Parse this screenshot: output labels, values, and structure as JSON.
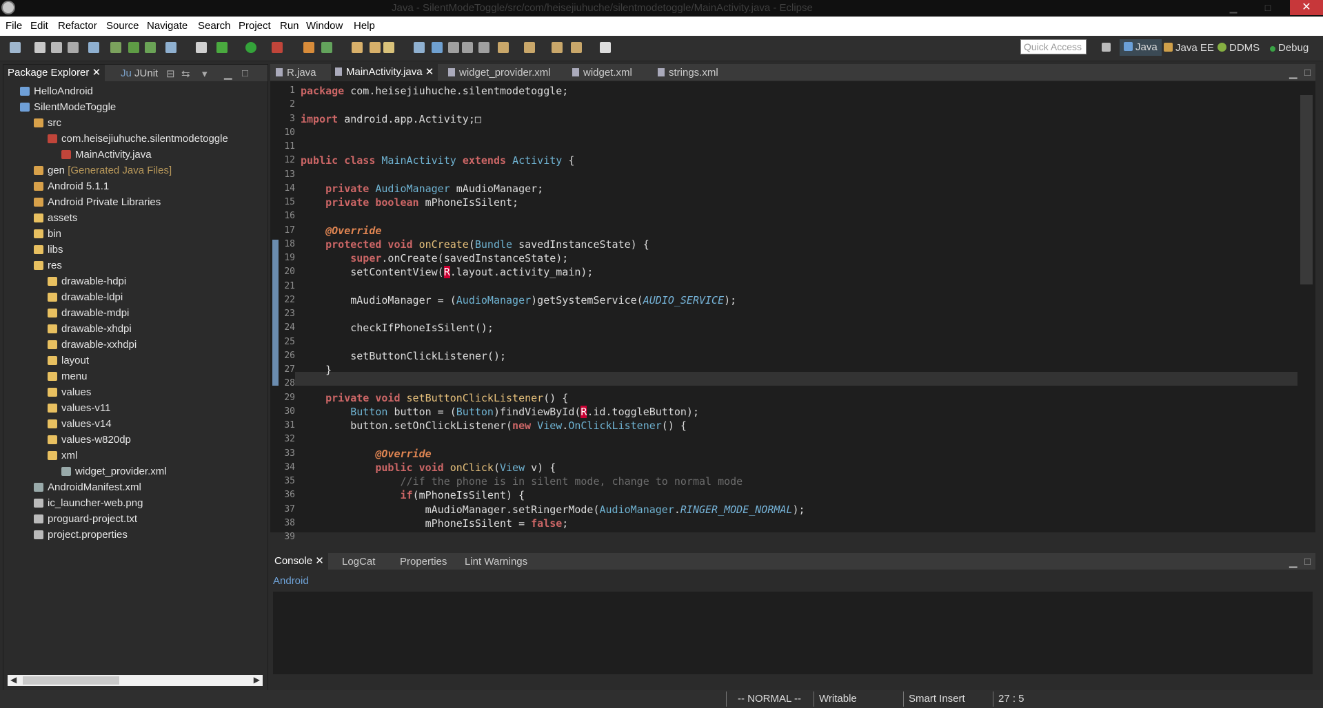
{
  "window": {
    "title": "Java - SilentModeToggle/src/com/heisejiuhuche/silentmodetoggle/MainActivity.java - Eclipse",
    "close": "✕",
    "minimize": "▁",
    "maximize": "□"
  },
  "menu": [
    "File",
    "Edit",
    "Refactor",
    "Source",
    "Navigate",
    "Search",
    "Project",
    "Run",
    "Window",
    "Help"
  ],
  "quick_access": "Quick Access",
  "perspectives": [
    "Java",
    "Java EE",
    "DDMS",
    "Debug"
  ],
  "left_tabs": {
    "explorer": "Package Explorer",
    "junit": "JUnit"
  },
  "tree": [
    {
      "label": "HelloAndroid",
      "indent": 0,
      "icon": "project-icon"
    },
    {
      "label": "SilentModeToggle",
      "indent": 0,
      "icon": "project-icon"
    },
    {
      "label": "src",
      "indent": 1,
      "icon": "source-folder-icon"
    },
    {
      "label": "com.heisejiuhuche.silentmodetoggle",
      "indent": 2,
      "icon": "package-icon"
    },
    {
      "label": "MainActivity.java",
      "indent": 3,
      "icon": "java-file-icon"
    },
    {
      "label": "gen",
      "extra": "[Generated Java Files]",
      "indent": 1,
      "icon": "source-folder-icon"
    },
    {
      "label": "Android 5.1.1",
      "indent": 1,
      "icon": "library-icon"
    },
    {
      "label": "Android Private Libraries",
      "indent": 1,
      "icon": "library-icon"
    },
    {
      "label": "assets",
      "indent": 1,
      "icon": "folder-icon"
    },
    {
      "label": "bin",
      "indent": 1,
      "icon": "folder-icon"
    },
    {
      "label": "libs",
      "indent": 1,
      "icon": "folder-icon"
    },
    {
      "label": "res",
      "indent": 1,
      "icon": "folder-icon"
    },
    {
      "label": "drawable-hdpi",
      "indent": 2,
      "icon": "folder-icon"
    },
    {
      "label": "drawable-ldpi",
      "indent": 2,
      "icon": "folder-icon"
    },
    {
      "label": "drawable-mdpi",
      "indent": 2,
      "icon": "folder-icon"
    },
    {
      "label": "drawable-xhdpi",
      "indent": 2,
      "icon": "folder-icon"
    },
    {
      "label": "drawable-xxhdpi",
      "indent": 2,
      "icon": "folder-icon"
    },
    {
      "label": "layout",
      "indent": 2,
      "icon": "folder-icon"
    },
    {
      "label": "menu",
      "indent": 2,
      "icon": "folder-icon"
    },
    {
      "label": "values",
      "indent": 2,
      "icon": "folder-icon"
    },
    {
      "label": "values-v11",
      "indent": 2,
      "icon": "folder-icon"
    },
    {
      "label": "values-v14",
      "indent": 2,
      "icon": "folder-icon"
    },
    {
      "label": "values-w820dp",
      "indent": 2,
      "icon": "folder-icon"
    },
    {
      "label": "xml",
      "indent": 2,
      "icon": "folder-icon"
    },
    {
      "label": "widget_provider.xml",
      "indent": 3,
      "icon": "xml-file-icon"
    },
    {
      "label": "AndroidManifest.xml",
      "indent": 1,
      "icon": "xml-file-icon"
    },
    {
      "label": "ic_launcher-web.png",
      "indent": 1,
      "icon": "file-icon"
    },
    {
      "label": "proguard-project.txt",
      "indent": 1,
      "icon": "file-icon"
    },
    {
      "label": "project.properties",
      "indent": 1,
      "icon": "file-icon"
    }
  ],
  "editor_tabs": [
    "R.java",
    "MainActivity.java",
    "widget_provider.xml",
    "widget.xml",
    "strings.xml"
  ],
  "code_lines": [
    {
      "n": "1",
      "html": "<span class='kw'>package</span> com.heisejiuhuche.silentmodetoggle;"
    },
    {
      "n": "2",
      "html": ""
    },
    {
      "n": "3",
      "html": "<span class='kw'>import</span> android.app.Activity;&#9633;"
    },
    {
      "n": "10",
      "html": ""
    },
    {
      "n": "11",
      "html": ""
    },
    {
      "n": "12",
      "html": "<span class='kw'>public class</span> <span class='ty'>MainActivity</span> <span class='kw'>extends</span> <span class='ty'>Activity</span> {"
    },
    {
      "n": "13",
      "html": ""
    },
    {
      "n": "14",
      "html": "    <span class='kw'>private</span> <span class='ty'>AudioManager</span> mAudioManager;"
    },
    {
      "n": "15",
      "html": "    <span class='kw'>private boolean</span> mPhoneIsSilent;"
    },
    {
      "n": "16",
      "html": ""
    },
    {
      "n": "17",
      "html": "    <span class='an'>@Override</span>"
    },
    {
      "n": "18",
      "html": "    <span class='kw'>protected void</span> <span class='fn'>onCreate</span>(<span class='ty'>Bundle</span> savedInstanceState) {"
    },
    {
      "n": "19",
      "html": "        <span class='kw'>super</span>.onCreate(savedInstanceState);"
    },
    {
      "n": "20",
      "html": "        setContentView(<span class='r'>R</span>.layout.activity_main);"
    },
    {
      "n": "21",
      "html": ""
    },
    {
      "n": "22",
      "html": "        mAudioManager = (<span class='ty'>AudioManager</span>)getSystemService(<span class='st'>AUDIO_SERVICE</span>);"
    },
    {
      "n": "23",
      "html": ""
    },
    {
      "n": "24",
      "html": "        checkIfPhoneIsSilent();"
    },
    {
      "n": "25",
      "html": ""
    },
    {
      "n": "26",
      "html": "        setButtonClickListener();"
    },
    {
      "n": "27",
      "html": "    }"
    },
    {
      "n": "28",
      "html": ""
    },
    {
      "n": "29",
      "html": "    <span class='kw'>private void</span> <span class='fn'>setButtonClickListener</span>() {"
    },
    {
      "n": "30",
      "html": "        <span class='ty'>Button</span> button = (<span class='ty'>Button</span>)findViewById(<span class='r'>R</span>.id.toggleButton);"
    },
    {
      "n": "31",
      "html": "        button.setOnClickListener(<span class='kw'>new</span> <span class='ty'>View</span>.<span class='ty'>OnClickListener</span>() {"
    },
    {
      "n": "32",
      "html": ""
    },
    {
      "n": "33",
      "html": "            <span class='an'>@Override</span>"
    },
    {
      "n": "34",
      "html": "            <span class='kw'>public void</span> <span class='fn'>onClick</span>(<span class='ty'>View</span> v) {"
    },
    {
      "n": "35",
      "html": "                <span class='cm'>//if the phone is in silent mode, change to normal mode</span>"
    },
    {
      "n": "36",
      "html": "                <span class='kw'>if</span>(mPhoneIsSilent) {"
    },
    {
      "n": "37",
      "html": "                    mAudioManager.setRingerMode(<span class='ty'>AudioManager</span>.<span class='st'>RINGER_MODE_NORMAL</span>);"
    },
    {
      "n": "38",
      "html": "                    mPhoneIsSilent = <span class='kw'>false</span>;"
    },
    {
      "n": "39",
      "html": "                } <span class='kw'>else</span> {"
    }
  ],
  "console_tabs": [
    "Console",
    "LogCat",
    "Properties",
    "Lint Warnings"
  ],
  "console_label": "Android",
  "status": {
    "mode": "-- NORMAL --",
    "writable": "Writable",
    "insert": "Smart Insert",
    "position": "27 : 5"
  },
  "colors": {
    "accent": "#6a8caf",
    "error": "#cc0033",
    "keyword": "#cc6666",
    "type": "#6fb3d2"
  }
}
